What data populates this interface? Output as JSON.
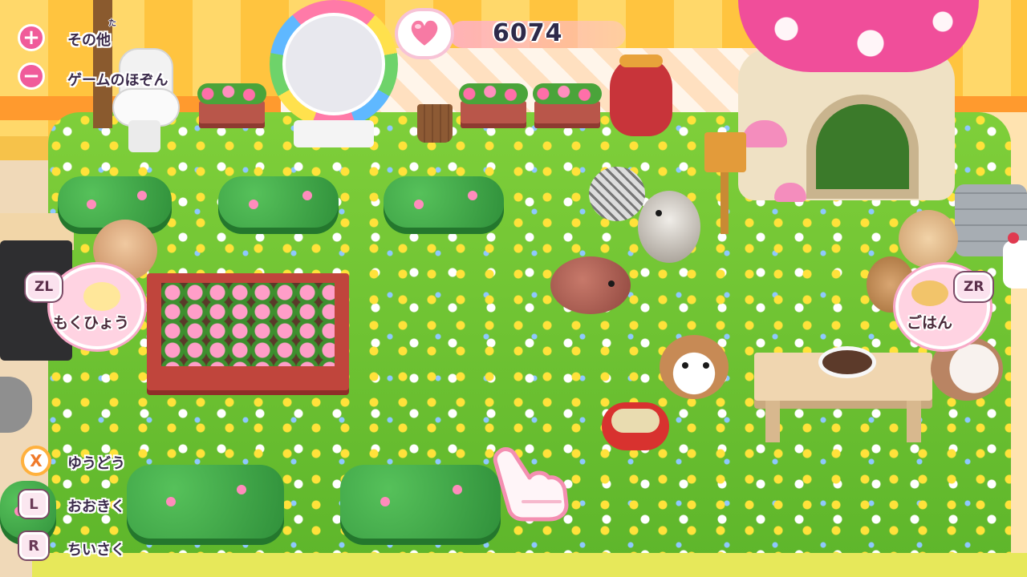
{
  "hud": {
    "plus_label": "その他",
    "plus_ruby": "た",
    "minus_label": "ゲームのほぞん",
    "plus_icon": "plus-icon",
    "minus_icon": "minus-icon"
  },
  "affection": {
    "icon": "heart-icon",
    "value": "6074",
    "heart_color": "#f77aa4"
  },
  "left_bubble": {
    "button": "ZL",
    "label": "もくひょう"
  },
  "right_bubble": {
    "button": "ZR",
    "label": "ごはん"
  },
  "controls": [
    {
      "button": "X",
      "label": "ゆうどう"
    },
    {
      "button": "L",
      "label": "おおきく"
    },
    {
      "button": "R",
      "label": "ちいさく"
    }
  ],
  "colors": {
    "accent_pink": "#f05b9a",
    "button_orange": "#ffb13d",
    "lawn_green": "#6cc232"
  }
}
